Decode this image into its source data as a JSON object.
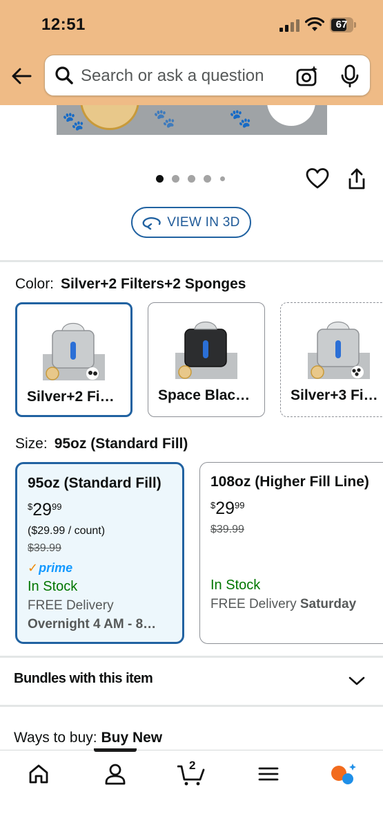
{
  "status_bar": {
    "time": "12:51",
    "battery": "67"
  },
  "search": {
    "placeholder": "Search or ask a question"
  },
  "carousel": {
    "dot_count": 5,
    "active_index": 0
  },
  "view3d": {
    "label": "VIEW IN 3D"
  },
  "color": {
    "label": "Color:",
    "selected": "Silver+2 Filters+2 Sponges",
    "swatches": [
      {
        "label": "Silver+2 Fi…",
        "selected": true
      },
      {
        "label": "Space Blac…",
        "selected": false
      },
      {
        "label": "Silver+3 Fi…",
        "selected": false
      }
    ]
  },
  "size": {
    "label": "Size:",
    "selected": "95oz (Standard Fill)",
    "options": [
      {
        "title": "95oz (Standard Fill)",
        "price_symbol": "$",
        "price_whole": "29",
        "price_fraction": "99",
        "unit_price": "($29.99 / count)",
        "list_price": "$39.99",
        "prime": "prime",
        "stock": "In Stock",
        "delivery": "FREE Delivery",
        "delivery_detail": "Overnight 4 AM - 8…"
      },
      {
        "title": "108oz (Higher Fill Line)",
        "price_symbol": "$",
        "price_whole": "29",
        "price_fraction": "99",
        "list_price": "$39.99",
        "stock": "In Stock",
        "delivery": "FREE Delivery",
        "delivery_day": "Saturday"
      }
    ]
  },
  "bundles": {
    "label": "Bundles with this item"
  },
  "ways_to_buy": {
    "label": "Ways to buy:",
    "value": "Buy New"
  },
  "bottom_nav": {
    "cart_count": "2",
    "items": [
      "home-icon",
      "account-icon",
      "cart-icon",
      "menu-icon",
      "rufus-icon"
    ]
  },
  "colors": {
    "header_bg": "#efbb86",
    "accent_blue": "#2162a1",
    "stock_green": "#007600",
    "prime_blue": "#1399ff"
  }
}
